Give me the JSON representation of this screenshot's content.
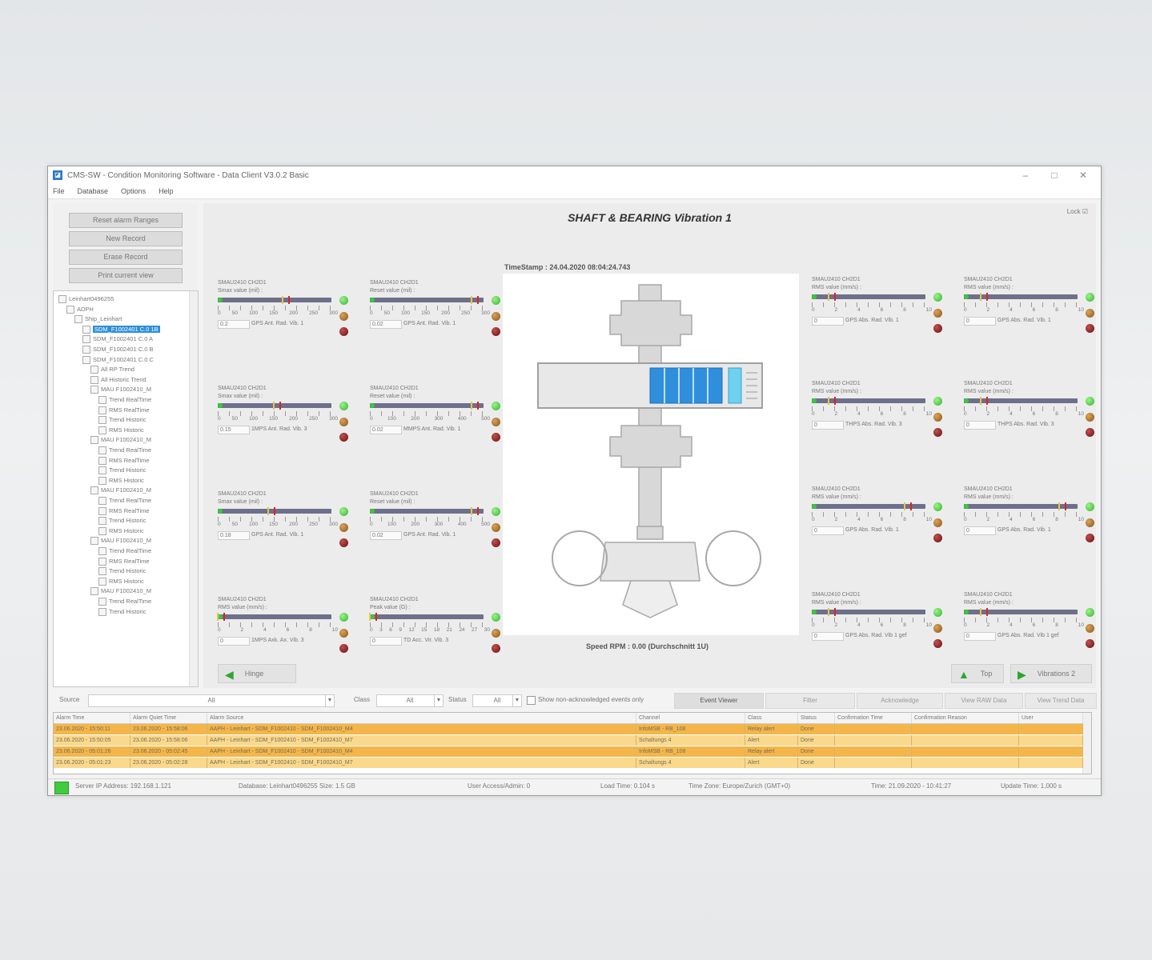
{
  "window": {
    "title": "CMS-SW - Condition Monitoring Software - Data Client V3.0.2 Basic",
    "controls": {
      "minimize": "–",
      "maximize": "□",
      "close": "✕"
    }
  },
  "menu": [
    "File",
    "Database",
    "Options",
    "Help"
  ],
  "left_buttons": [
    "Reset alarm Ranges",
    "New Record",
    "Erase Record",
    "Print current view"
  ],
  "tree": [
    {
      "label": "Leinhart0496255",
      "level": 0
    },
    {
      "label": "ADPH",
      "level": 1
    },
    {
      "label": "Ship_Leinhart",
      "level": 2
    },
    {
      "label": "SDM_F1002401 C.0 1B",
      "level": 3,
      "selected": true
    },
    {
      "label": "SDM_F1002401 C.0 A",
      "level": 3
    },
    {
      "label": "SDM_F1002401 C.0 B",
      "level": 3
    },
    {
      "label": "SDM_F1002401 C.0 C",
      "level": 3
    },
    {
      "label": "All RP Trend",
      "level": 4
    },
    {
      "label": "All Historic Trend",
      "level": 4
    },
    {
      "label": "MAU F1002410_M",
      "level": 4
    },
    {
      "label": "Trend RealTime",
      "level": 5
    },
    {
      "label": "RMS RealTime",
      "level": 5
    },
    {
      "label": "Trend Historic",
      "level": 5
    },
    {
      "label": "RMS Historic",
      "level": 5
    },
    {
      "label": "MAU F1002410_M",
      "level": 4
    },
    {
      "label": "Trend RealTime",
      "level": 5
    },
    {
      "label": "RMS RealTime",
      "level": 5
    },
    {
      "label": "Trend Historic",
      "level": 5
    },
    {
      "label": "RMS Historic",
      "level": 5
    },
    {
      "label": "MAU F1002410_M",
      "level": 4
    },
    {
      "label": "Trend RealTime",
      "level": 5
    },
    {
      "label": "RMS RealTime",
      "level": 5
    },
    {
      "label": "Trend Historic",
      "level": 5
    },
    {
      "label": "RMS Historic",
      "level": 5
    },
    {
      "label": "MAU F1002410_M",
      "level": 4
    },
    {
      "label": "Trend RealTime",
      "level": 5
    },
    {
      "label": "RMS RealTime",
      "level": 5
    },
    {
      "label": "Trend Historic",
      "level": 5
    },
    {
      "label": "RMS Historic",
      "level": 5
    },
    {
      "label": "MAU F1002410_M",
      "level": 4
    },
    {
      "label": "Trend RealTime",
      "level": 5
    },
    {
      "label": "Trend Historic",
      "level": 5
    }
  ],
  "main": {
    "title": "SHAFT & BEARING Vibration 1",
    "lock_label": "Lock",
    "timestamp": "TimeStamp : 24.04.2020 08:04:24.743",
    "speed": "Speed RPM : 0.00 (Durchschnitt 1U)"
  },
  "gauges_left": [
    {
      "channel": "SMAU2410 CH2D1",
      "subtitle": "Smax value (mil) :",
      "scale": [
        "0",
        "50",
        "100",
        "150",
        "200",
        "250",
        "300"
      ],
      "value": "0.2",
      "name": "GPS Ant. Rad. Vib. 1",
      "level": 0.63
    },
    {
      "channel": "SMAU2410 CH2D1",
      "subtitle": "Reset value (mil) :",
      "scale": [
        "0",
        "50",
        "100",
        "150",
        "200",
        "250",
        "300"
      ],
      "value": "0.02",
      "name": "GPS Ant. Rad. Vib. 1",
      "level": 0.96
    },
    {
      "channel": "SMAU2410 CH2D1",
      "subtitle": "Smax value (mil) :",
      "scale": [
        "0",
        "50",
        "100",
        "150",
        "200",
        "250",
        "300"
      ],
      "value": "0.15",
      "name": "1MPS Ant. Rad. Vib. 3",
      "level": 0.55
    },
    {
      "channel": "SMAU2410 CH2D1",
      "subtitle": "Reset value (mil) :",
      "scale": [
        "0",
        "100",
        "200",
        "300",
        "400",
        "500"
      ],
      "value": "0.02",
      "name": "MMPS Ant. Rad. Vib. 1",
      "level": 0.96
    },
    {
      "channel": "SMAU2410 CH2D1",
      "subtitle": "Smax value (mil) :",
      "scale": [
        "0",
        "50",
        "100",
        "150",
        "200",
        "250",
        "300"
      ],
      "value": "0.18",
      "name": "GPS Ant. Rad. Vib. 1",
      "level": 0.5
    },
    {
      "channel": "SMAU2410 CH2D1",
      "subtitle": "Reset value (mil) :",
      "scale": [
        "0",
        "100",
        "200",
        "300",
        "400",
        "500"
      ],
      "value": "0.02",
      "name": "GPS Ant. Rad. Vib. 1",
      "level": 0.96
    },
    {
      "channel": "SMAU2410 CH2D1",
      "subtitle": "RMS value (mm/s) :",
      "scale": [
        "0",
        "2",
        "4",
        "6",
        "8",
        "10"
      ],
      "value": "0",
      "name": "1MPS Axk. Ax. Vib. 3",
      "level": 0.05
    },
    {
      "channel": "SMAU2410 CH2D1",
      "subtitle": "Peak value (G) :",
      "scale": [
        "0",
        "3",
        "6",
        "9",
        "12",
        "15",
        "18",
        "21",
        "24",
        "27",
        "30"
      ],
      "value": "0",
      "name": "TD Acc. Vir. Vib. 3",
      "level": 0.05
    }
  ],
  "gauges_right": [
    {
      "channel": "SMAU2410 CH2D1",
      "subtitle": "RMS value (mm/s) :",
      "scale": [
        "0",
        "2",
        "4",
        "6",
        "8",
        "10"
      ],
      "value": "0",
      "name": "GPS Abs. Rad. Vib. 1",
      "level": 0.2
    },
    {
      "channel": "SMAU2410 CH2D1",
      "subtitle": "RMS value (mm/s) :",
      "scale": [
        "0",
        "2",
        "4",
        "6",
        "8",
        "10"
      ],
      "value": "0",
      "name": "GPS Abs. Rad. Vib. 1",
      "level": 0.2
    },
    {
      "channel": "SMAU2410 CH2D1",
      "subtitle": "RMS value (mm/s) :",
      "scale": [
        "0",
        "2",
        "4",
        "6",
        "8",
        "10"
      ],
      "value": "0",
      "name": "THPS Abs. Rad. Vib. 3",
      "level": 0.2
    },
    {
      "channel": "SMAU2410 CH2D1",
      "subtitle": "RMS value (mm/s) :",
      "scale": [
        "0",
        "2",
        "4",
        "6",
        "8",
        "10"
      ],
      "value": "0",
      "name": "THPS Abs. Rad. Vib. 3",
      "level": 0.2
    },
    {
      "channel": "SMAU2410 CH2D1",
      "subtitle": "RMS value (mm/s) :",
      "scale": [
        "0",
        "2",
        "4",
        "6",
        "8",
        "10"
      ],
      "value": "0",
      "name": "GPS Abs. Rad. Vib. 1",
      "level": 0.88
    },
    {
      "channel": "SMAU2410 CH2D1",
      "subtitle": "RMS value (mm/s) :",
      "scale": [
        "0",
        "2",
        "4",
        "6",
        "8",
        "10"
      ],
      "value": "0",
      "name": "GPS Abs. Rad. Vib. 1",
      "level": 0.9
    },
    {
      "channel": "SMAU2410 CH2D1",
      "subtitle": "RMS value (mm/s) :",
      "scale": [
        "0",
        "2",
        "4",
        "6",
        "8",
        "10"
      ],
      "value": "0",
      "name": "GPS Abs. Rad. Vib 1 gef",
      "level": 0.2
    },
    {
      "channel": "SMAU2410 CH2D1",
      "subtitle": "RMS value (mm/s) :",
      "scale": [
        "0",
        "2",
        "4",
        "6",
        "8",
        "10"
      ],
      "value": "0",
      "name": "GPS Abs. Rad. Vib 1 gef",
      "level": 0.2
    }
  ],
  "nav": {
    "back": "Hinge",
    "top": "Top",
    "next": "Vibrations 2"
  },
  "filters": {
    "source_label": "Source",
    "source_value": "All",
    "class_label": "Class",
    "class_value": "All",
    "status_label": "Status",
    "status_value": "All",
    "unack_label": "Show non-acknowledged events only",
    "buttons": [
      "Event Viewer",
      "Filter",
      "Acknowledge",
      "View RAW Data",
      "View Trend Data"
    ]
  },
  "alarm_table": {
    "headers": [
      "Alarm Time",
      "Alarm Quiet Time",
      "Alarm Source",
      "Channel",
      "Class",
      "Status",
      "Confirmation Time",
      "Confirmation Reason",
      "User"
    ],
    "rows": [
      [
        "23.06.2020 - 15:50:11",
        "23.06.2020 - 15:58:06",
        "AAPH - Leinhart - SDM_F1002410 - SDM_F1002410_M4",
        "InfoMSB - RB_108",
        "Relay alert",
        "Done",
        "",
        "",
        ""
      ],
      [
        "23.06.2020 - 15:50:05",
        "23.06.2020 - 15:58:06",
        "AAPH - Leinhart - SDM_F1002410 - SDM_F1002410_M7",
        "Schaltungs 4",
        "Alert",
        "Done",
        "",
        "",
        ""
      ],
      [
        "23.06.2020 - 05:01:26",
        "23.06.2020 - 05:02:45",
        "AAPH - Leinhart - SDM_F1002410 - SDM_F1002410_M4",
        "InfoMSB - RB_108",
        "Relay alert",
        "Done",
        "",
        "",
        ""
      ],
      [
        "23.06.2020 - 05:01:23",
        "23.06.2020 - 05:02:28",
        "AAPH - Leinhart - SDM_F1002410 - SDM_F1002410_M7",
        "Schaltungs 4",
        "Alert",
        "Done",
        "",
        "",
        ""
      ]
    ],
    "row_colors": [
      "#f4b64a",
      "#fbd98c",
      "#f4b64a",
      "#fbd98c"
    ]
  },
  "statusbar": {
    "server": "Server IP Address: 192.168.1.121",
    "database": "Database: Leinhart0496255   Size: 1.5 GB",
    "user_access": "User Access/Admin: 0",
    "load_time": "Load Time: 0.104 s",
    "time_zone": "Time Zone: Europe/Zurich (GMT+0)",
    "time": "Time: 21.09.2020 - 10:41:27",
    "update_time": "Update Time: 1,000 s"
  },
  "colors": {
    "accent": "#2f8fdc",
    "ok": "#39c839",
    "warn": "#d8a35c",
    "alarm": "#c05050",
    "bar": "#6e6f8a"
  }
}
